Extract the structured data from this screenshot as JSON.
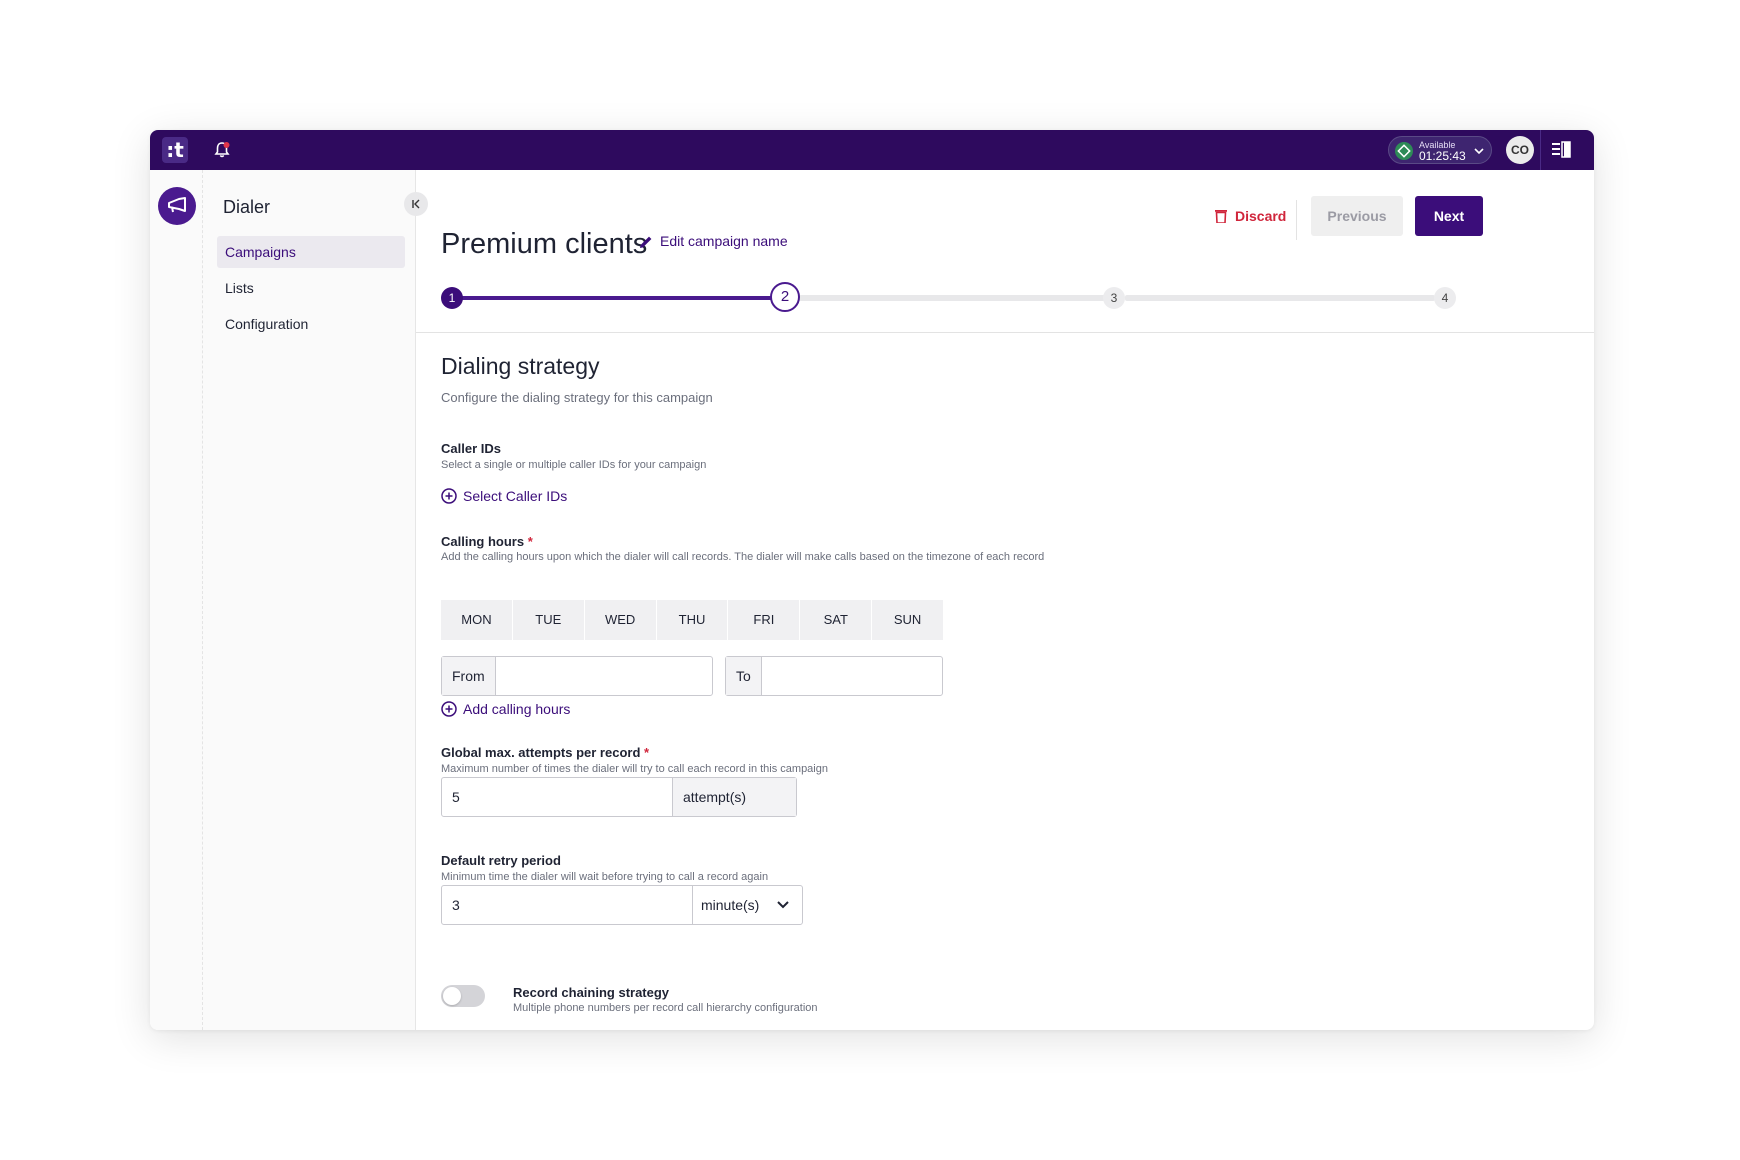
{
  "topbar": {
    "logo": ":t",
    "status_label": "Available",
    "status_time": "01:25:43",
    "avatar_initials": "CO",
    "brand_color": "#2e0a5e",
    "status_color": "#2e8b57"
  },
  "sidebar": {
    "title": "Dialer",
    "items": [
      {
        "label": "Campaigns",
        "active": true
      },
      {
        "label": "Lists",
        "active": false
      },
      {
        "label": "Configuration",
        "active": false
      }
    ]
  },
  "header": {
    "title": "Premium clients",
    "edit_label": "Edit campaign name",
    "discard_label": "Discard",
    "previous_label": "Previous",
    "next_label": "Next"
  },
  "stepper": {
    "steps": [
      "1",
      "2",
      "3",
      "4"
    ],
    "current": 2
  },
  "section": {
    "title": "Dialing strategy",
    "subtitle": "Configure the dialing strategy for this campaign"
  },
  "caller_ids": {
    "label": "Caller IDs",
    "help": "Select a single or multiple caller IDs for your campaign",
    "action": "Select Caller IDs"
  },
  "calling_hours": {
    "label": "Calling hours",
    "required_mark": "*",
    "help": "Add the calling hours upon which the dialer will call records. The dialer will make calls based on the timezone of each record",
    "days": [
      "MON",
      "TUE",
      "WED",
      "THU",
      "FRI",
      "SAT",
      "SUN"
    ],
    "from_label": "From",
    "from_value": "",
    "to_label": "To",
    "to_value": "",
    "action": "Add calling hours"
  },
  "max_attempts": {
    "label": "Global max. attempts per record",
    "required_mark": "*",
    "help": "Maximum number of times the dialer will try to call each record in this campaign",
    "value": "5",
    "unit": "attempt(s)"
  },
  "retry_period": {
    "label": "Default retry period",
    "help": "Minimum time the dialer will wait before trying to call a record again",
    "value": "3",
    "unit": "minute(s)"
  },
  "record_chaining": {
    "label": "Record chaining strategy",
    "help": "Multiple phone numbers per record call hierarchy configuration",
    "enabled": false
  }
}
